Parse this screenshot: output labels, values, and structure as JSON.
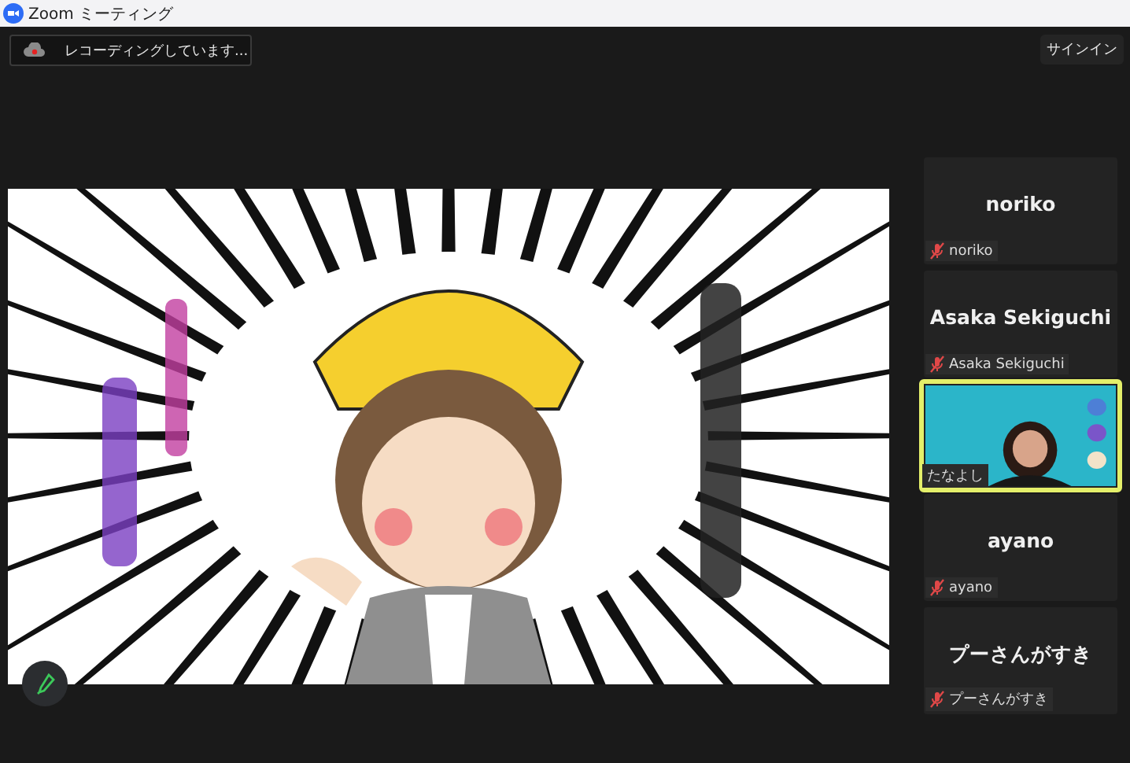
{
  "window": {
    "title": "Zoom ミーティング"
  },
  "recording": {
    "label": "レコーディングしています..."
  },
  "sign_in": {
    "label": "サインイン"
  },
  "participants": [
    {
      "kind": "avatar",
      "name": "noriko",
      "label": "noriko",
      "muted": true,
      "speaking": false
    },
    {
      "kind": "avatar",
      "name": "Asaka Sekiguchi",
      "label": "Asaka Sekiguchi",
      "muted": true,
      "speaking": false
    },
    {
      "kind": "video",
      "label": "たなよし",
      "muted": false,
      "speaking": true
    },
    {
      "kind": "avatar",
      "name": "ayano",
      "label": "ayano",
      "muted": true,
      "speaking": false
    },
    {
      "kind": "avatar",
      "name": "プーさんがすき",
      "label": "プーさんがすき",
      "muted": true,
      "speaking": false
    }
  ]
}
